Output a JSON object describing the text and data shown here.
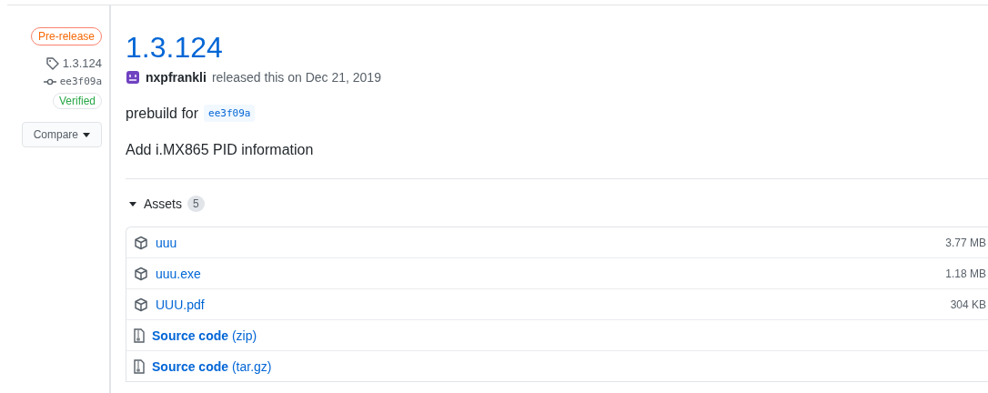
{
  "sidebar": {
    "label": "Pre-release",
    "tag": "1.3.124",
    "commit": "ee3f09a",
    "verified": "Verified",
    "compare": "Compare"
  },
  "release": {
    "title": "1.3.124",
    "author": "nxpfrankli",
    "meta": "released this on Dec 21, 2019",
    "body_prefix": "prebuild for",
    "body_commit": "ee3f09a",
    "notes": "Add i.MX865 PID information"
  },
  "assets": {
    "label": "Assets",
    "count": "5",
    "expanded": true,
    "items": [
      {
        "kind": "package",
        "name": "uuu",
        "size": "3.77 MB"
      },
      {
        "kind": "package",
        "name": "uuu.exe",
        "size": "1.18 MB"
      },
      {
        "kind": "package",
        "name": "UUU.pdf",
        "size": "304 KB"
      },
      {
        "kind": "source",
        "name": "**Source code** (zip)"
      },
      {
        "kind": "source",
        "name": "**Source code** (tar.gz)"
      }
    ]
  }
}
